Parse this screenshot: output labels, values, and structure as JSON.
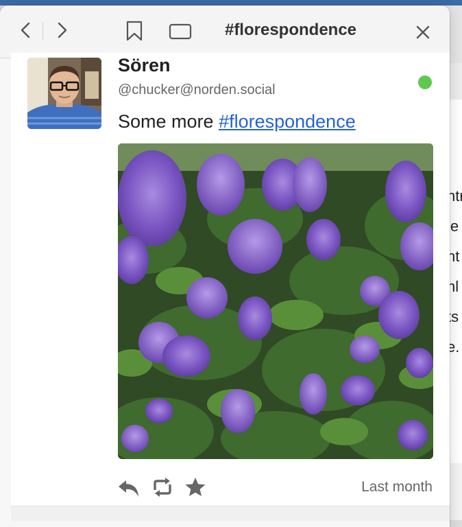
{
  "window": {
    "title": "#florespondence"
  },
  "toolbar": {
    "icons": [
      "back-icon",
      "forward-icon",
      "bookmark-icon",
      "window-icon",
      "close-icon"
    ]
  },
  "post": {
    "author_name": "Sören",
    "author_handle": "@chucker@norden.social",
    "status": "online",
    "status_color": "#5ec94d",
    "text_prefix": "Some more ",
    "hashtag": "#florespondence",
    "hashtag_color": "#2463d0",
    "timestamp": "Last month",
    "actions": [
      "reply-icon",
      "boost-icon",
      "star-icon"
    ]
  },
  "background_window": {
    "fragments": [
      "ntr",
      "le",
      "nt",
      "nl",
      "ts",
      "e."
    ]
  }
}
